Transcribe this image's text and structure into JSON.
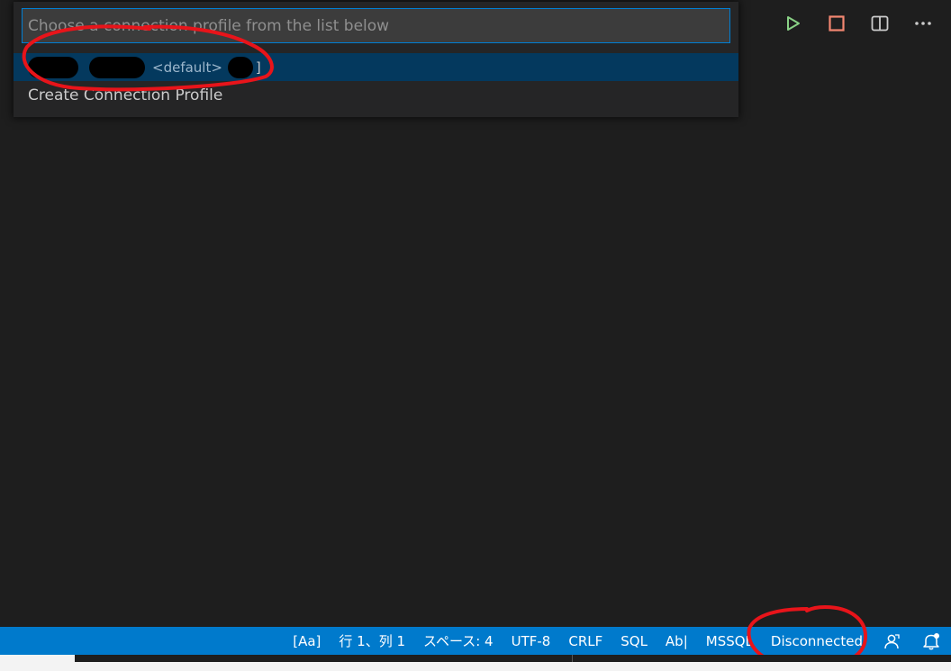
{
  "quick_pick": {
    "placeholder": "Choose a connection profile from the list below",
    "items": [
      {
        "description": "<default>",
        "suffix": "]"
      },
      {
        "label": "Create Connection Profile"
      }
    ]
  },
  "editor_actions": [
    "run-icon",
    "stop-icon",
    "split-editor-icon",
    "more-actions-icon"
  ],
  "status_bar": {
    "items": [
      "[Aa]",
      "行 1、列 1",
      "スペース: 4",
      "UTF-8",
      "CRLF",
      "SQL",
      "Ab|",
      "MSSQL",
      "Disconnected"
    ],
    "icons": [
      "feedback-icon",
      "notifications-icon"
    ]
  },
  "colors": {
    "status_bar": "#007acc",
    "selection": "#04395e",
    "annotation": "#e8141a",
    "run": "#89d185",
    "stop": "#f48771"
  }
}
